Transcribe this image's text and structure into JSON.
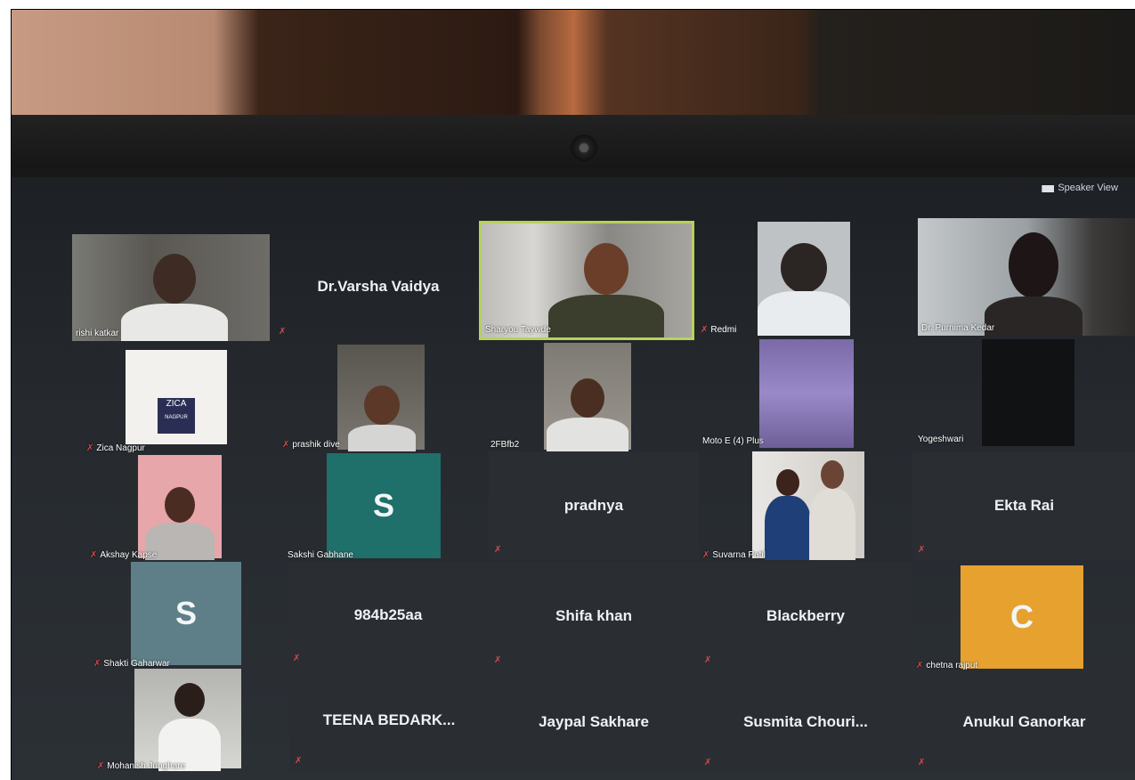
{
  "app": {
    "speaker_view_label": "Speaker View"
  },
  "participants": [
    {
      "id": "p01",
      "name": "rishi katkar"
    },
    {
      "id": "p02",
      "name": "Dr.Varsha Vaidya"
    },
    {
      "id": "p03",
      "name": "Sharyou Taywde"
    },
    {
      "id": "p04",
      "name": "Redmi"
    },
    {
      "id": "p05",
      "name": "Dr. Purnima Kedar"
    },
    {
      "id": "p06",
      "name": "Zica Nagpur"
    },
    {
      "id": "p07",
      "name": "prashik dive"
    },
    {
      "id": "p08",
      "name": "2FBfb2"
    },
    {
      "id": "p09",
      "name": "Moto E (4) Plus"
    },
    {
      "id": "p10",
      "name": "Yogeshwari"
    },
    {
      "id": "p11",
      "name": "Akshay Kapse"
    },
    {
      "id": "p12",
      "name": "Sakshi Gabhane",
      "initial": "S"
    },
    {
      "id": "p13",
      "name": "pradnya"
    },
    {
      "id": "p14",
      "name": "Suvarna Patil"
    },
    {
      "id": "p15",
      "name": "Ekta Rai"
    },
    {
      "id": "p16",
      "name": "Shakti Gaharwar",
      "initial": "S"
    },
    {
      "id": "p17",
      "name": "984b25aa"
    },
    {
      "id": "p18",
      "name": "Shifa khan"
    },
    {
      "id": "p19",
      "name": "Blackberry"
    },
    {
      "id": "p20",
      "name": "chetna rajput",
      "initial": "C"
    },
    {
      "id": "p21",
      "name": "Mohanish Junghare"
    },
    {
      "id": "p22",
      "name": "TEENA BEDARK..."
    },
    {
      "id": "p23",
      "name": "Jaypal Sakhare"
    },
    {
      "id": "p24",
      "name": "Susmita Chouri..."
    },
    {
      "id": "p25",
      "name": "Anukul Ganorkar"
    }
  ],
  "logo_text": {
    "line1": "ZICA",
    "line2": "NAGPUR"
  },
  "colors": {
    "active_speaker_border": "#b7d25a",
    "muted_icon": "#d84848",
    "avatar_teal": "#1f6f6a",
    "avatar_slate": "#5f7f88",
    "avatar_orange": "#e7a12f"
  },
  "icons": {
    "muted": "microphone-muted-icon",
    "speaker_view": "speaker-view-grid-icon"
  }
}
